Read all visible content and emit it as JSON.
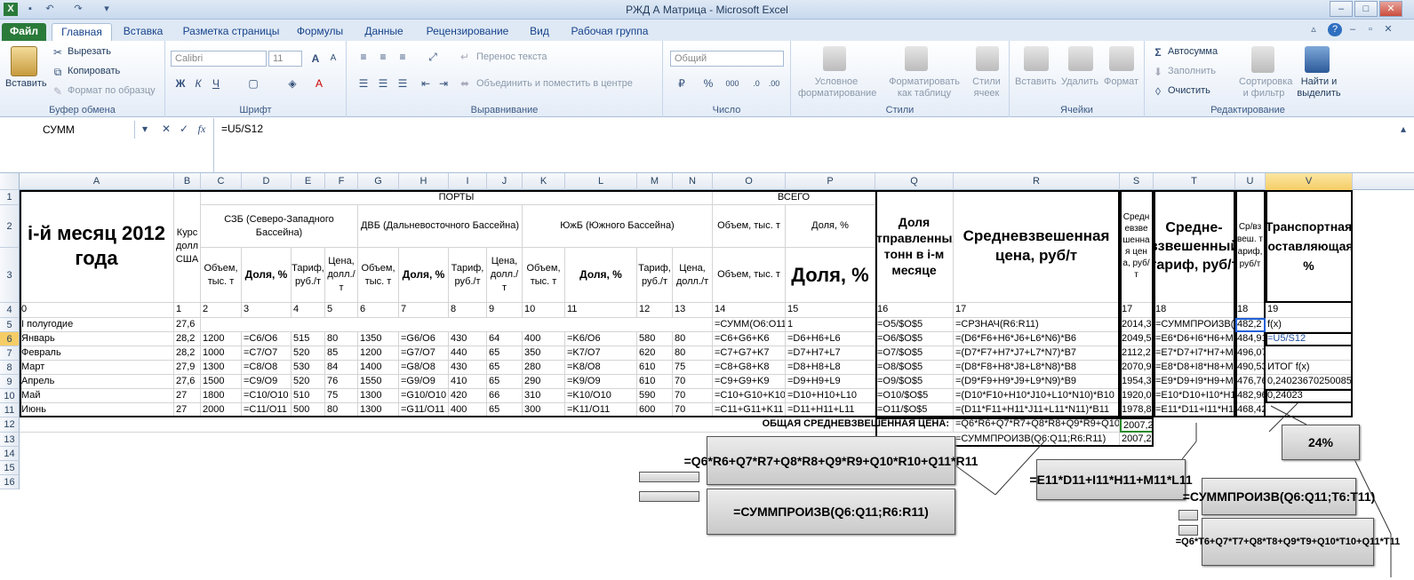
{
  "window": {
    "title": "РЖД А Матрица  -  Microsoft Excel"
  },
  "tabs": [
    "Файл",
    "Главная",
    "Вставка",
    "Разметка страницы",
    "Формулы",
    "Данные",
    "Рецензирование",
    "Вид",
    "Рабочая группа"
  ],
  "ribbon": {
    "clipboard": {
      "label": "Буфер обмена",
      "paste": "Вставить",
      "cut": "Вырезать",
      "copy": "Копировать",
      "format": "Формат по образцу"
    },
    "font": {
      "label": "Шрифт",
      "name": "Calibri",
      "size": "11",
      "bold": "Ж",
      "italic": "К",
      "underline": "Ч",
      "grow": "A",
      "shrink": "A"
    },
    "align": {
      "label": "Выравнивание",
      "wrap": "Перенос текста",
      "merge": "Объединить и поместить в центре"
    },
    "number": {
      "label": "Число",
      "format": "Общий",
      "percent": "%",
      "thousands": "000"
    },
    "styles": {
      "label": "Стили",
      "cond": "Условное форматирование",
      "table": "Форматировать как таблицу",
      "cells": "Стили ячеек"
    },
    "cells": {
      "label": "Ячейки",
      "insert": "Вставить",
      "delete": "Удалить",
      "format": "Формат"
    },
    "edit": {
      "label": "Редактирование",
      "autosum": "Автосумма",
      "fill": "Заполнить",
      "clear": "Очистить",
      "sort": "Сортировка и фильтр",
      "find": "Найти и выделить"
    }
  },
  "formulabar": {
    "namebox": "СУММ",
    "fx": "fx",
    "formula": "=U5/S12"
  },
  "columns": [
    "A",
    "B",
    "C",
    "D",
    "E",
    "F",
    "G",
    "H",
    "I",
    "J",
    "K",
    "L",
    "M",
    "N",
    "O",
    "P",
    "Q",
    "R",
    "S",
    "T",
    "U",
    "V"
  ],
  "rows": [
    "1",
    "2",
    "3",
    "4",
    "5",
    "6",
    "7",
    "8",
    "9",
    "10",
    "11",
    "12",
    "13",
    "14",
    "15",
    "16"
  ],
  "headers": {
    "month": "i-й месяц 2012 года",
    "usd": "Курс долл США",
    "ports": "ПОРТЫ",
    "total": "ВСЕГО",
    "szb": "СЗБ (Северо-Западного Бассейна)",
    "dvb": "ДВБ (Дальневосточного Бассейна)",
    "yub": "ЮжБ (Южного Бассейна)",
    "vol": "Объем, тыс. т",
    "share": "Доля, %",
    "tarif": "Тариф, руб./т",
    "price": "Цена, долл./т",
    "vol_total": "Объем, тыс. т",
    "share_total": "Доля, %",
    "share_big": "Доля, %",
    "q": "Доля отправленных тонн в i-м месяце",
    "r": "Средневзвешенная цена, руб/т",
    "s": "Средневзвешенная цена, руб/т",
    "t": "Средне-взвешенный тариф, руб/т",
    "u": "Ср/взвеш. тариф, руб/т",
    "v": "Транспортная составляющая, %"
  },
  "row4": [
    "0",
    "1",
    "2",
    "3",
    "4",
    "5",
    "6",
    "7",
    "8",
    "9",
    "10",
    "11",
    "12",
    "13",
    "14",
    "15",
    "16",
    "17",
    "17",
    "18",
    "18",
    "19"
  ],
  "data": [
    [
      "I полугодие",
      "27,6",
      "",
      "",
      "",
      "",
      "",
      "",
      "",
      "",
      "",
      "",
      "",
      "",
      "=СУММ(O6:O11",
      "1",
      "=O5/$O$5",
      "=СРЗНАЧ(R6:R11)",
      "2014,3",
      "=СУММПРОИЗВ(Q",
      "482,2",
      "f(x)"
    ],
    [
      "Январь",
      "28,2",
      "1200",
      "=C6/O6",
      "515",
      "80",
      "1350",
      "=G6/O6",
      "430",
      "64",
      "400",
      "=K6/O6",
      "580",
      "80",
      "=C6+G6+K6",
      "=D6+H6+L6",
      "=O6/$O$5",
      "=(D6*F6+H6*J6+L6*N6)*B6",
      "2049,5",
      "=E6*D6+I6*H6+M",
      "484,91",
      "=U5/S12"
    ],
    [
      "Февраль",
      "28,2",
      "1000",
      "=C7/O7",
      "520",
      "85",
      "1200",
      "=G7/O7",
      "440",
      "65",
      "350",
      "=K7/O7",
      "620",
      "80",
      "=C7+G7+K7",
      "=D7+H7+L7",
      "=O7/$O$5",
      "=(D7*F7+H7*J7+L7*N7)*B7",
      "2112,2",
      "=E7*D7+I7*H7+M",
      "496,07",
      ""
    ],
    [
      "Март",
      "27,9",
      "1300",
      "=C8/O8",
      "530",
      "84",
      "1400",
      "=G8/O8",
      "430",
      "65",
      "280",
      "=K8/O8",
      "610",
      "75",
      "=C8+G8+K8",
      "=D8+H8+L8",
      "=O8/$O$5",
      "=(D8*F8+H8*J8+L8*N8)*B8",
      "2070,9",
      "=E8*D8+I8*H8+M",
      "490,53",
      "ИТОГ    f(x)"
    ],
    [
      "Апрель",
      "27,6",
      "1500",
      "=C9/O9",
      "520",
      "76",
      "1550",
      "=G9/O9",
      "410",
      "65",
      "290",
      "=K9/O9",
      "610",
      "70",
      "=C9+G9+K9",
      "=D9+H9+L9",
      "=O9/$O$5",
      "=(D9*F9+H9*J9+L9*N9)*B9",
      "1954,3",
      "=E9*D9+I9*H9+M",
      "476,76",
      "0,240236702500853"
    ],
    [
      "Май",
      "27",
      "1800",
      "=C10/O10",
      "510",
      "75",
      "1300",
      "=G10/O10",
      "420",
      "66",
      "310",
      "=K10/O10",
      "590",
      "70",
      "=C10+G10+K10",
      "=D10+H10+L10",
      "=O10/$O$5",
      "=(D10*F10+H10*J10+L10*N10)*B10",
      "1920,0",
      "=E10*D10+I10*H1",
      "482,96",
      "0,24023"
    ],
    [
      "Июнь",
      "27",
      "2000",
      "=C11/O11",
      "500",
      "80",
      "1300",
      "=G11/O11",
      "400",
      "65",
      "300",
      "=K11/O11",
      "600",
      "70",
      "=C11+G11+K11",
      "=D11+H11+L11",
      "=O11/$O$5",
      "=(D11*F11+H11*J11+L11*N11)*B11",
      "1978,8",
      "=E11*D11+I11*H1",
      "468,42",
      ""
    ]
  ],
  "row12": {
    "label": "ОБЩАЯ СРЕДНЕВЗВЕШЕННАЯ ЦЕНА:",
    "r": "=Q6*R6+Q7*R7+Q8*R8+Q9*R9+Q10*",
    "s": "2007,2"
  },
  "row13": {
    "r": "=СУММПРОИЗВ(Q6:Q11;R6:R11)",
    "s": "2007,2"
  },
  "callouts": {
    "c1": "=Q6*R6+Q7*R7+Q8*R8+Q9*R9+Q10*R10+Q11*R11",
    "c2": "=СУММПРОИЗВ(Q6:Q11;R6:R11)",
    "c3": "=E11*D11+I11*H11+M11*L11",
    "c4": "24%",
    "c5": "=СУММПРОИЗВ(Q6:Q11;T6:T11)",
    "c6": "=Q6*T6+Q7*T7+Q8*T8+Q9*T9+Q10*T10+Q11*T11"
  }
}
